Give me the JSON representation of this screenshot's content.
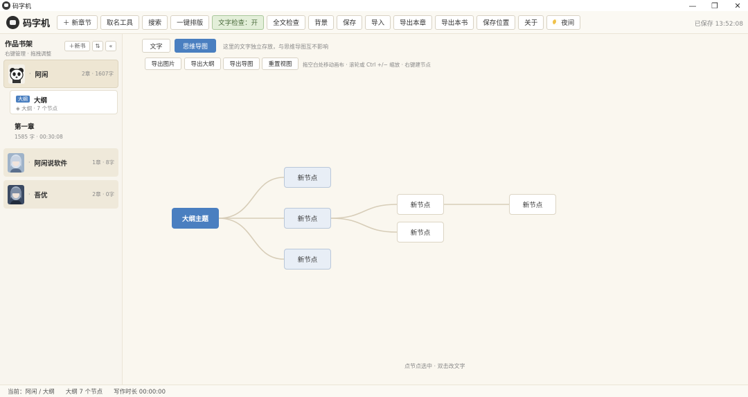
{
  "window": {
    "title": "码字机",
    "minimize_glyph": "—",
    "restore_glyph": "❐",
    "close_glyph": "✕"
  },
  "toolbar": {
    "brand": "码字机",
    "new_chapter": "＋ 新章节",
    "naming_tool": "取名工具",
    "search": "搜索",
    "one_key_layout": "一键排版",
    "text_check": "文字检查：开",
    "full_check": "全文检查",
    "background": "背景",
    "save": "保存",
    "import": "导入",
    "export_chapter": "导出本章",
    "export_book": "导出本书",
    "save_location": "保存位置",
    "about": "关于",
    "night": "夜间",
    "saved_status": "已保存 13:52:08"
  },
  "sidebar": {
    "title": "作品书架",
    "hint": "右键管理 · 拖拽调整",
    "new_book": "＋新书",
    "sort_icon_glyph": "⇅",
    "collapse_icon_glyph": "«",
    "books": [
      {
        "dot": "·",
        "name": "阿闲",
        "meta": "2章 · 1607字",
        "avatar": "panda-avatar"
      },
      {
        "dot": "·",
        "name": "阿闲说软件",
        "meta": "1章 · 8字",
        "avatar": "anime-avatar-blue"
      },
      {
        "dot": "·",
        "name": "吾优",
        "meta": "2章 · 0字",
        "avatar": "anime-avatar-dark"
      }
    ],
    "outline": {
      "badge": "大纲",
      "name": "大纲",
      "sub": "◈ 大纲 · 7 个节点"
    },
    "chapter": {
      "name": "第一章",
      "meta": "1585 字 · 00:30:08"
    }
  },
  "main": {
    "tab_text": "文字",
    "tab_mindmap": "思维导图",
    "tab_note": "这里的文字独立存放，与思维导图互不影响",
    "export_image": "导出图片",
    "export_outline": "导出大纲",
    "export_map": "导出导图",
    "reset_view": "重置视图",
    "action_note": "拖空白处移动画布 · 滚轮或 Ctrl +/− 缩放 · 右键建节点",
    "canvas_hint": "点节点选中 · 双击改文字"
  },
  "mindmap": {
    "root": "大纲主题",
    "level1": [
      "新节点",
      "新节点",
      "新节点"
    ],
    "level2": [
      "新节点",
      "新节点"
    ],
    "level3": [
      "新节点"
    ]
  },
  "status": {
    "current": "当前：阿闲 / 大纲",
    "nodes": "大纲 7 个节点",
    "writing_time": "写作时长 00:00:00"
  },
  "colors": {
    "accent": "#4a7fc0",
    "background": "#faf7ef",
    "sidebar": "#f8f5ee",
    "book_card": "#efe9da",
    "active_toggle": "#e3efd9",
    "connector": "#d7cdb8"
  }
}
